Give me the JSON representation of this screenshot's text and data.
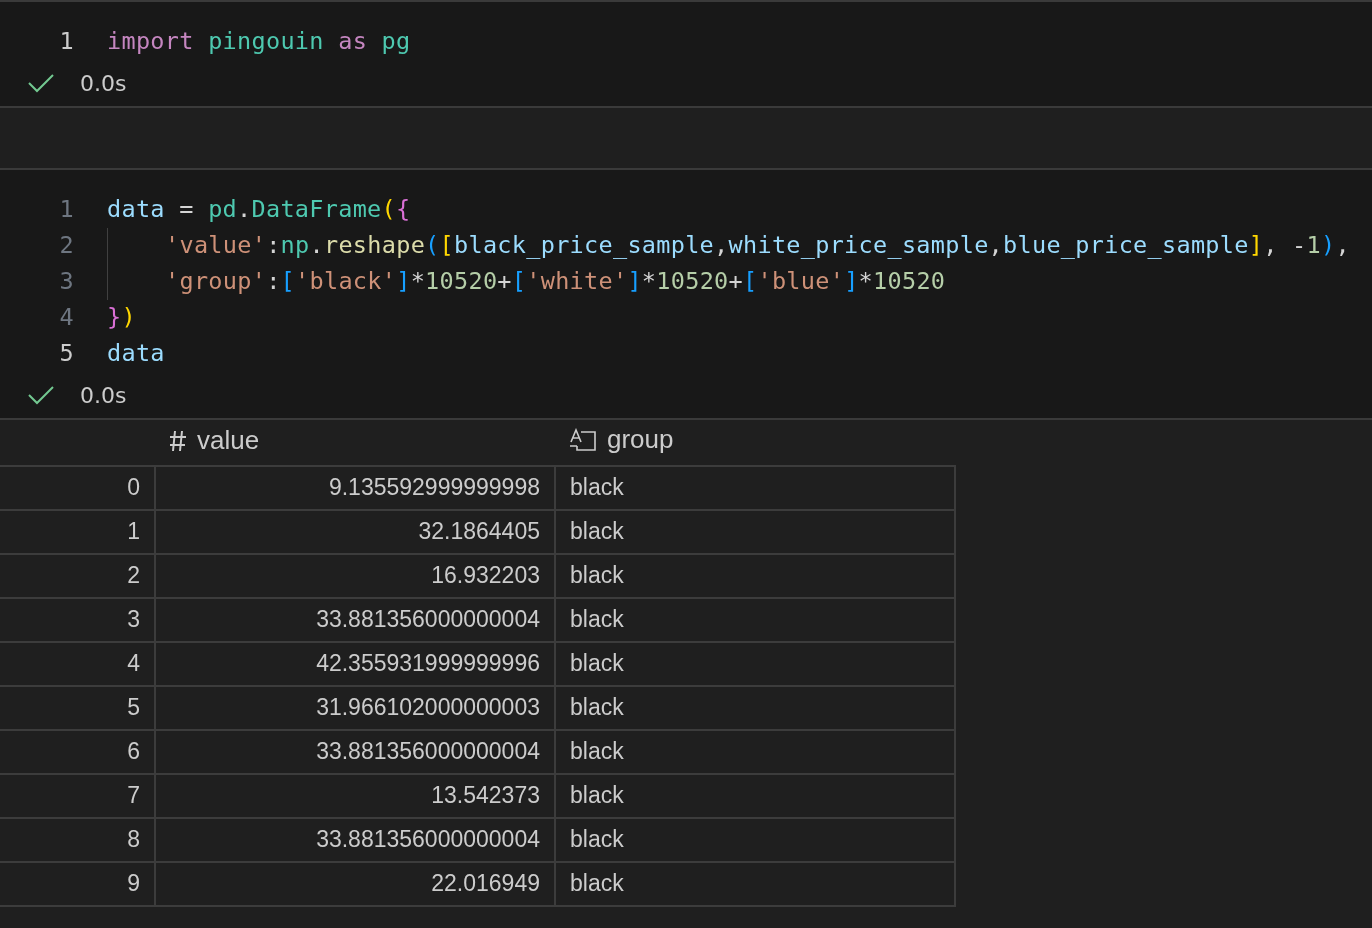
{
  "cells": [
    {
      "lines": [
        {
          "number": "1",
          "current": true,
          "indent_guide": false,
          "tokens": [
            {
              "kind": "keyword",
              "text": "import "
            },
            {
              "kind": "module",
              "text": "pingouin "
            },
            {
              "kind": "keyword",
              "text": "as "
            },
            {
              "kind": "module",
              "text": "pg"
            }
          ]
        }
      ],
      "status": {
        "success": true,
        "time": "0.0s"
      }
    },
    {
      "lines": [
        {
          "number": "1",
          "current": false,
          "indent_guide": false,
          "tokens": [
            {
              "kind": "variable",
              "text": "data"
            },
            {
              "kind": "plain",
              "text": " = "
            },
            {
              "kind": "module",
              "text": "pd"
            },
            {
              "kind": "plain",
              "text": "."
            },
            {
              "kind": "module",
              "text": "DataFrame"
            },
            {
              "kind": "bracket1",
              "text": "("
            },
            {
              "kind": "bracket2",
              "text": "{"
            }
          ]
        },
        {
          "number": "2",
          "current": false,
          "indent_guide": true,
          "tokens": [
            {
              "kind": "string",
              "text": "'value'"
            },
            {
              "kind": "plain",
              "text": ":"
            },
            {
              "kind": "module",
              "text": "np"
            },
            {
              "kind": "plain",
              "text": "."
            },
            {
              "kind": "function",
              "text": "reshape"
            },
            {
              "kind": "bracket3",
              "text": "("
            },
            {
              "kind": "bracket1",
              "text": "["
            },
            {
              "kind": "variable",
              "text": "black_price_sample"
            },
            {
              "kind": "plain",
              "text": ","
            },
            {
              "kind": "variable",
              "text": "white_price_sample"
            },
            {
              "kind": "plain",
              "text": ","
            },
            {
              "kind": "variable",
              "text": "blue_price_sample"
            },
            {
              "kind": "bracket1",
              "text": "]"
            },
            {
              "kind": "plain",
              "text": ", -"
            },
            {
              "kind": "number",
              "text": "1"
            },
            {
              "kind": "bracket3",
              "text": ")"
            },
            {
              "kind": "plain",
              "text": ","
            }
          ]
        },
        {
          "number": "3",
          "current": false,
          "indent_guide": true,
          "tokens": [
            {
              "kind": "string",
              "text": "'group'"
            },
            {
              "kind": "plain",
              "text": ":"
            },
            {
              "kind": "bracket3",
              "text": "["
            },
            {
              "kind": "string",
              "text": "'black'"
            },
            {
              "kind": "bracket3",
              "text": "]"
            },
            {
              "kind": "plain",
              "text": "*"
            },
            {
              "kind": "number",
              "text": "10520"
            },
            {
              "kind": "plain",
              "text": "+"
            },
            {
              "kind": "bracket3",
              "text": "["
            },
            {
              "kind": "string",
              "text": "'white'"
            },
            {
              "kind": "bracket3",
              "text": "]"
            },
            {
              "kind": "plain",
              "text": "*"
            },
            {
              "kind": "number",
              "text": "10520"
            },
            {
              "kind": "plain",
              "text": "+"
            },
            {
              "kind": "bracket3",
              "text": "["
            },
            {
              "kind": "string",
              "text": "'blue'"
            },
            {
              "kind": "bracket3",
              "text": "]"
            },
            {
              "kind": "plain",
              "text": "*"
            },
            {
              "kind": "number",
              "text": "10520"
            }
          ]
        },
        {
          "number": "4",
          "current": false,
          "indent_guide": false,
          "tokens": [
            {
              "kind": "bracket2",
              "text": "}"
            },
            {
              "kind": "bracket1",
              "text": ")"
            }
          ]
        },
        {
          "number": "5",
          "current": true,
          "indent_guide": false,
          "tokens": [
            {
              "kind": "variable",
              "text": "data"
            }
          ]
        }
      ],
      "status": {
        "success": true,
        "time": "0.0s"
      },
      "output": {
        "columns": [
          {
            "label": "value",
            "kind": "number"
          },
          {
            "label": "group",
            "kind": "string"
          }
        ],
        "rows": [
          {
            "index": "0",
            "cells": [
              "9.135592999999998",
              "black"
            ]
          },
          {
            "index": "1",
            "cells": [
              "32.1864405",
              "black"
            ]
          },
          {
            "index": "2",
            "cells": [
              "16.932203",
              "black"
            ]
          },
          {
            "index": "3",
            "cells": [
              "33.881356000000004",
              "black"
            ]
          },
          {
            "index": "4",
            "cells": [
              "42.355931999999996",
              "black"
            ]
          },
          {
            "index": "5",
            "cells": [
              "31.966102000000003",
              "black"
            ]
          },
          {
            "index": "6",
            "cells": [
              "33.881356000000004",
              "black"
            ]
          },
          {
            "index": "7",
            "cells": [
              "13.542373",
              "black"
            ]
          },
          {
            "index": "8",
            "cells": [
              "33.881356000000004",
              "black"
            ]
          },
          {
            "index": "9",
            "cells": [
              "22.016949",
              "black"
            ]
          }
        ]
      }
    }
  ]
}
